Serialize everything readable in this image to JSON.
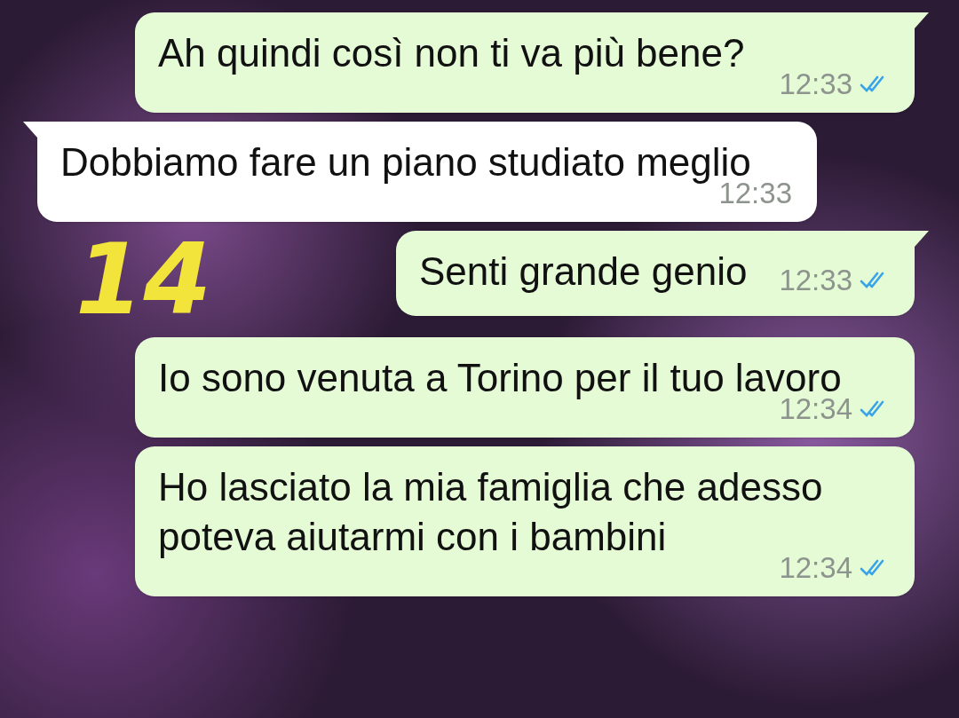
{
  "messages": [
    {
      "kind": "block",
      "outgoing": true,
      "tail": true,
      "text": "Ah quindi così non ti va più bene?",
      "time": "12:33",
      "read": true
    },
    {
      "kind": "block",
      "outgoing": false,
      "tail": true,
      "text": "Dobbiamo fare un piano studiato meglio",
      "time": "12:33"
    },
    {
      "kind": "inline",
      "outgoing": true,
      "tail": true,
      "text": "Senti grande genio",
      "time": "12:33",
      "read": true
    },
    {
      "kind": "block",
      "outgoing": true,
      "tail": false,
      "text": "Io sono venuta a Torino per il tuo lavoro",
      "time": "12:34",
      "read": true
    },
    {
      "kind": "block",
      "outgoing": true,
      "tail": false,
      "text": "Ho lasciato la mia famiglia che adesso poteva aiutarmi con i bambini",
      "time": "12:34",
      "read": true
    }
  ],
  "annotation": {
    "text": "14",
    "color": "#f2e43a"
  }
}
